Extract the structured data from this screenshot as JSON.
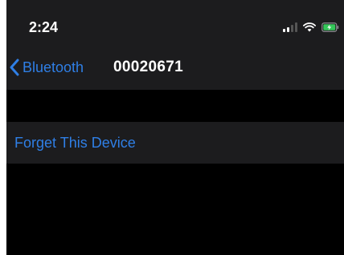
{
  "status_bar": {
    "time": "2:24",
    "icons": [
      "signal-icon",
      "wifi-icon",
      "battery-charging-icon"
    ]
  },
  "nav": {
    "back_label": "Bluetooth",
    "title": "00020671"
  },
  "actions": {
    "forget_label": "Forget This Device"
  },
  "colors": {
    "accent": "#2f7fe6",
    "background": "#000000",
    "grouped_cell": "#1c1c1e",
    "text_primary": "#ffffff",
    "battery_charging": "#34c759"
  }
}
